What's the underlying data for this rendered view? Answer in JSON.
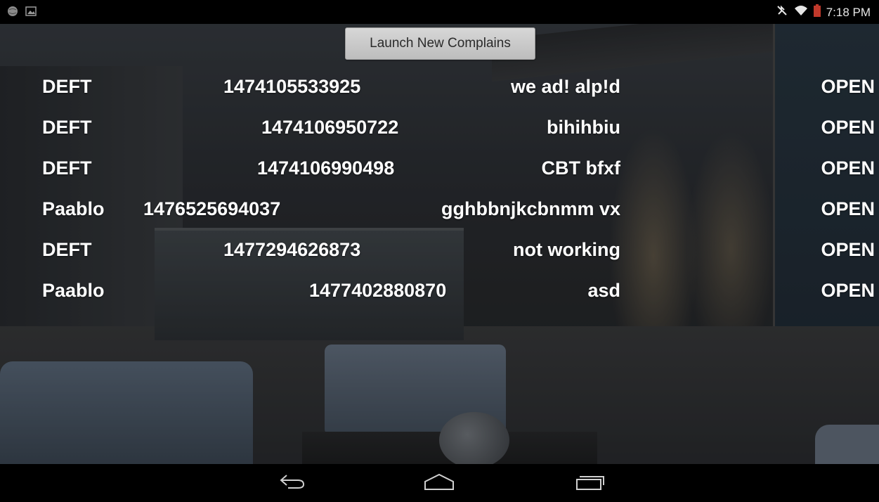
{
  "status_bar": {
    "time": "7:18 PM",
    "left_icons": [
      "globe-icon",
      "image-icon"
    ],
    "right_icons": [
      "mute-icon",
      "wifi-icon",
      "battery-icon"
    ]
  },
  "toolbar": {
    "launch_label": "Launch New Complains"
  },
  "complaints": [
    {
      "name": "DEFT",
      "id": "1474105533925",
      "description": "we ad! alp!d",
      "status": "OPEN"
    },
    {
      "name": "DEFT",
      "id": "1474106950722",
      "description": "bihihbiu",
      "status": "OPEN"
    },
    {
      "name": "DEFT",
      "id": "1474106990498",
      "description": "CBT bfxf",
      "status": "OPEN"
    },
    {
      "name": "Paablo",
      "id": "1476525694037",
      "description": "gghbbnjkcbnmm vx",
      "status": "OPEN"
    },
    {
      "name": "DEFT",
      "id": "1477294626873",
      "description": "not working",
      "status": "OPEN"
    },
    {
      "name": "Paablo",
      "id": "1477402880870",
      "description": "asd",
      "status": "OPEN"
    }
  ],
  "nav_bar": {
    "icons": [
      "back-icon",
      "home-icon",
      "recent-apps-icon"
    ]
  },
  "colors": {
    "text": "#ffffff",
    "button_bg": "#c9c9c9",
    "bars": "#000000"
  }
}
